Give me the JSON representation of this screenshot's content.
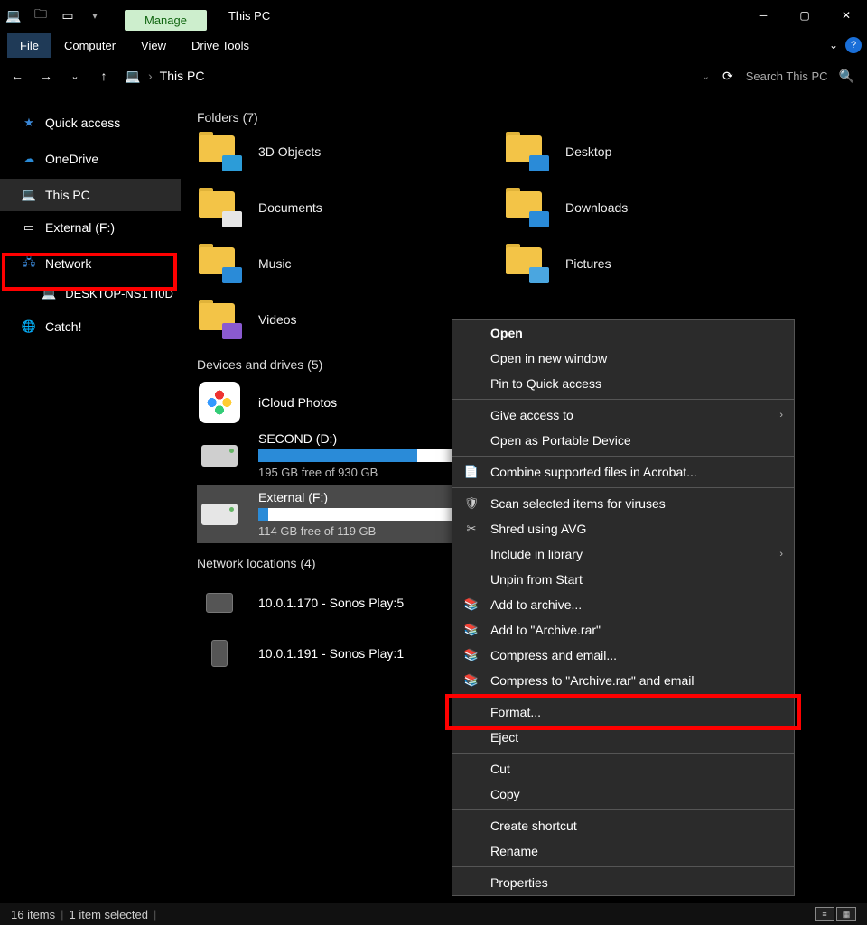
{
  "titlebar": {
    "manage": "Manage",
    "title": "This PC"
  },
  "ribbon": {
    "file": "File",
    "computer": "Computer",
    "view": "View",
    "drive_tools": "Drive Tools"
  },
  "address": {
    "current": "This PC",
    "search_placeholder": "Search This PC"
  },
  "sidebar": {
    "quick_access": "Quick access",
    "onedrive": "OneDrive",
    "this_pc": "This PC",
    "external": "External (F:)",
    "network": "Network",
    "desktop_node": "DESKTOP-NS1TI0D",
    "catch": "Catch!"
  },
  "sections": {
    "folders_header": "Folders (7)",
    "drives_header": "Devices and drives (5)",
    "network_header": "Network locations (4)"
  },
  "folders": {
    "0": "3D Objects",
    "1": "Desktop",
    "2": "Documents",
    "3": "Downloads",
    "4": "Music",
    "5": "Pictures",
    "6": "Videos"
  },
  "drives": {
    "icloud": {
      "name": "iCloud Photos"
    },
    "second": {
      "name": "SECOND (D:)",
      "free": "195 GB free of 930 GB",
      "fill_pct": 80
    },
    "external": {
      "name": "External (F:)",
      "free": "114 GB free of 119 GB",
      "fill_pct": 5
    }
  },
  "network": {
    "0": "10.0.1.170 - Sonos Play:5",
    "1": "10.0.1.191 - Sonos Play:1"
  },
  "context_menu": {
    "open": "Open",
    "open_new": "Open in new window",
    "pin_quick": "Pin to Quick access",
    "give_access": "Give access to",
    "open_portable": "Open as Portable Device",
    "combine_acrobat": "Combine supported files in Acrobat...",
    "scan_virus": "Scan selected items for viruses",
    "shred_avg": "Shred using AVG",
    "include_lib": "Include in library",
    "unpin_start": "Unpin from Start",
    "add_archive": "Add to archive...",
    "add_archive_rar": "Add to \"Archive.rar\"",
    "compress_email": "Compress and email...",
    "compress_rar_email": "Compress to \"Archive.rar\" and email",
    "format": "Format...",
    "eject": "Eject",
    "cut": "Cut",
    "copy": "Copy",
    "create_shortcut": "Create shortcut",
    "rename": "Rename",
    "properties": "Properties"
  },
  "status": {
    "items": "16 items",
    "selected": "1 item selected"
  }
}
